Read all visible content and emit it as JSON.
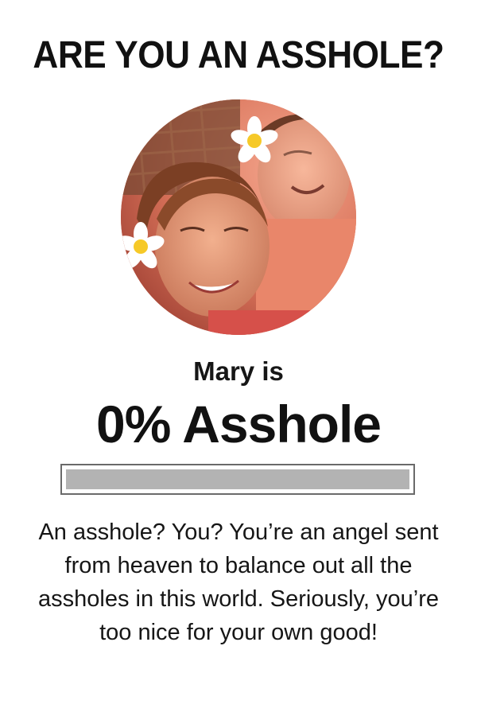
{
  "quiz": {
    "title": "ARE YOU AN ASSHOLE?"
  },
  "result": {
    "name_line": "Mary is",
    "score_line": "0% Asshole",
    "score_fraction": 0.0,
    "description": "An asshole? You? You’re an angel sent from heaven to balance out all the assholes in this world. Seriously, you’re too nice for your own good!"
  },
  "avatar": {
    "icon": "profile-photo",
    "accent_color": "#e07a5f",
    "flower_color": "#ffffff"
  },
  "colors": {
    "meter_track": "#b3b3b3",
    "meter_border": "#6a6a6a",
    "text": "#111111"
  }
}
